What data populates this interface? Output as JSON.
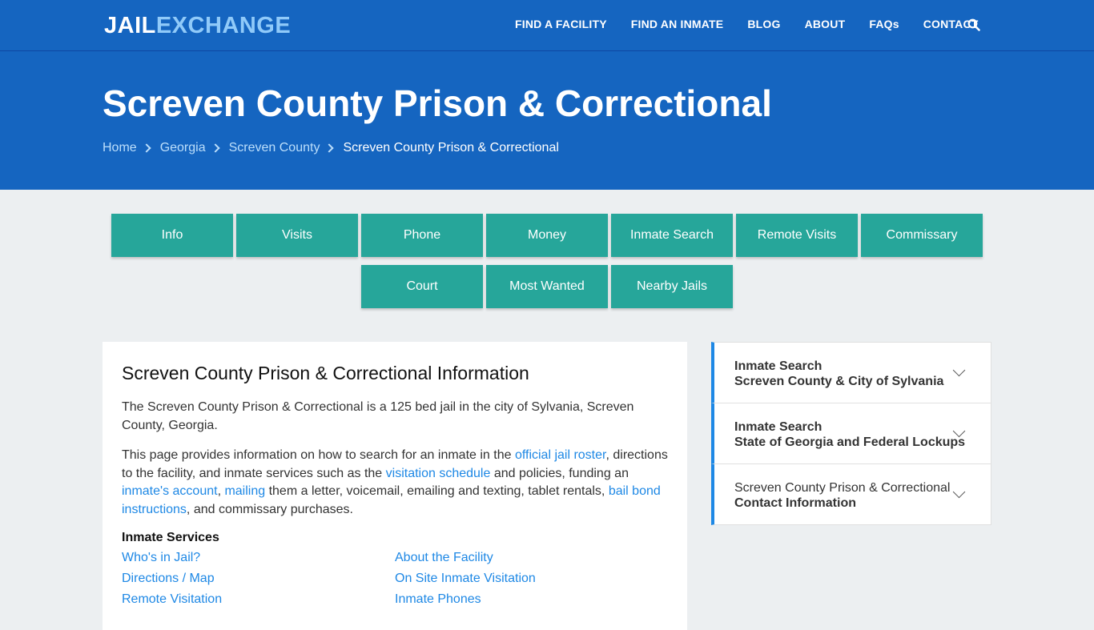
{
  "header": {
    "logo_part1": "JAIL",
    "logo_part2": "EXCHANGE",
    "nav": [
      "FIND A FACILITY",
      "FIND AN INMATE",
      "BLOG",
      "ABOUT",
      "FAQs",
      "CONTACT"
    ],
    "search_icon": "search-icon"
  },
  "hero": {
    "title": "Screven County Prison & Correctional",
    "breadcrumb": [
      "Home",
      "Georgia",
      "Screven County",
      "Screven County Prison & Correctional"
    ]
  },
  "tabs": [
    "Info",
    "Visits",
    "Phone",
    "Money",
    "Inmate Search",
    "Remote Visits",
    "Commissary",
    "Court",
    "Most Wanted",
    "Nearby Jails"
  ],
  "main": {
    "heading": "Screven County Prison & Correctional Information",
    "para1": "The Screven County Prison & Correctional is a 125 bed jail in the city of Sylvania, Screven County, Georgia.",
    "para2": {
      "t1": "This page provides information on how to search for an inmate in the ",
      "l1": "official jail roster",
      "t2": ", directions to the facility, and inmate services such as the ",
      "l2": "visitation schedule",
      "t3": " and policies, funding an ",
      "l3": "inmate's account",
      "t4": ", ",
      "l4": "mailing",
      "t5": " them a letter, voicemail, emailing and texting, tablet rentals, ",
      "l5": "bail bond instructions",
      "t6": ", and commissary purchases."
    },
    "services_heading": "Inmate Services",
    "services": [
      "Who's in Jail?",
      "About the Facility",
      "Directions / Map",
      "On Site Inmate Visitation",
      "Remote Visitation",
      "Inmate Phones"
    ]
  },
  "sidebar": {
    "items": [
      {
        "line1": "Inmate Search",
        "line2": "Screven County & City of Sylvania"
      },
      {
        "line1": "Inmate Search",
        "line2": "State of Georgia and Federal Lockups"
      },
      {
        "line1": "Screven County Prison & Correctional",
        "line2": "Contact Information"
      }
    ]
  },
  "colors": {
    "header_blue": "#1565c0",
    "tab_teal": "#26a69a",
    "link_blue": "#1e88e5",
    "background": "#eceff1"
  }
}
